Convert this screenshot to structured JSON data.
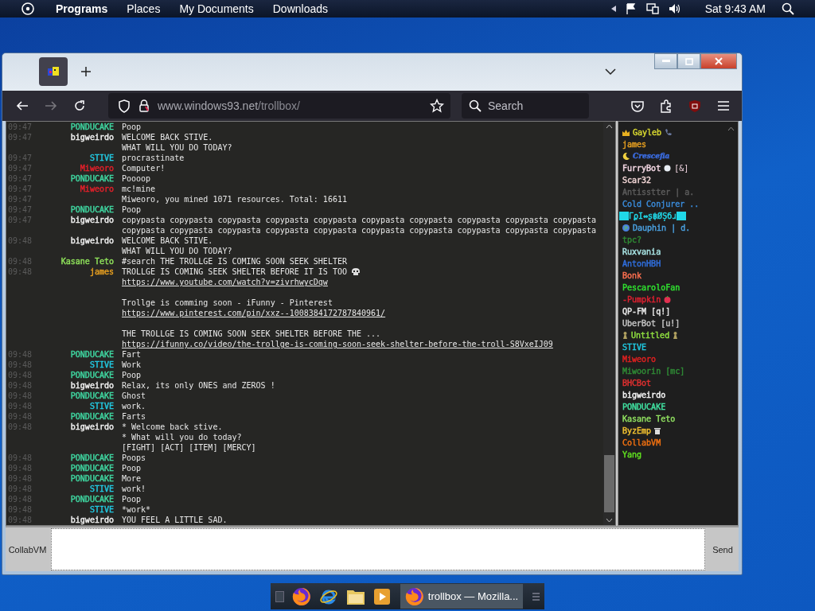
{
  "top_panel": {
    "menus": [
      "Programs",
      "Places",
      "My Documents",
      "Downloads"
    ],
    "clock": "Sat 9:43 AM"
  },
  "browser": {
    "tabs": [
      {
        "selected": true
      }
    ],
    "url_host": "www.windows93.net",
    "url_path": "/trollbox/",
    "search": {
      "placeholder": "Search"
    }
  },
  "chat": {
    "messages": [
      {
        "time": "09:47",
        "nick": "PONDUCAKE",
        "color": "#3fd6a0",
        "lines": [
          {
            "text": "Poop"
          }
        ]
      },
      {
        "time": "09:47",
        "nick": "bigweirdo",
        "color": "#f0f0f0",
        "lines": [
          {
            "text": "WELCOME BACK STIVE."
          },
          {
            "text": "WHAT WILL YOU DO TODAY?"
          }
        ]
      },
      {
        "time": "09:47",
        "nick": "STIVE",
        "color": "#22c8e0",
        "lines": [
          {
            "text": "procrastinate"
          }
        ]
      },
      {
        "time": "09:47",
        "nick": "Miweoro",
        "color": "#e0202a",
        "lines": [
          {
            "text": "Computer!"
          }
        ]
      },
      {
        "time": "09:47",
        "nick": "PONDUCAKE",
        "color": "#3fd6a0",
        "lines": [
          {
            "text": "Poooop"
          }
        ]
      },
      {
        "time": "09:47",
        "nick": "Miweoro",
        "color": "#e0202a",
        "lines": [
          {
            "text": "mc!mine"
          }
        ]
      },
      {
        "time": "09:47",
        "lines": [
          {
            "text": "Miweoro, you mined 1071 resources. Total: 16611"
          }
        ]
      },
      {
        "time": "09:47",
        "nick": "PONDUCAKE",
        "color": "#3fd6a0",
        "lines": [
          {
            "text": "Poop"
          }
        ]
      },
      {
        "time": "09:47",
        "nick": "bigweirdo",
        "color": "#f0f0f0",
        "lines": [
          {
            "text": "copypasta copypasta copypasta copypasta copypasta copypasta copypasta copypasta copypasta copypasta"
          },
          {
            "text": "copypasta copypasta copypasta copypasta copypasta copypasta copypasta copypasta copypasta copypasta"
          }
        ]
      },
      {
        "time": "09:48",
        "nick": "bigweirdo",
        "color": "#f0f0f0",
        "lines": [
          {
            "text": "WELCOME BACK STIVE."
          },
          {
            "text": "WHAT WILL YOU DO TODAY?"
          }
        ]
      },
      {
        "time": "09:48",
        "nick": "Kasane Teto",
        "color": "#8ee05a",
        "lines": [
          {
            "text": "#search THE TROLLGE IS COMING SOON SEEK SHELTER"
          }
        ]
      },
      {
        "time": "09:48",
        "nick": "james",
        "color": "#e8a020",
        "lines": [
          {
            "text": "TROLLGE IS COMING SEEK SHELTER BEFORE IT IS TOO"
          },
          {
            "text": "https://www.youtube.com/watch?v=zivrhwycDqw",
            "link": true
          },
          {
            "text": "Trollge is comming soon - iFunny - Pinterest",
            "space_before": true
          },
          {
            "text": "https://www.pinterest.com/pin/xxz--1008384172787840961/",
            "link": true
          },
          {
            "text": "THE TROLLGE IS COMING SOON SEEK SHELTER BEFORE THE ...",
            "space_before": true
          },
          {
            "text": "https://ifunny.co/video/the-trollge-is-coming-soon-seek-shelter-before-the-troll-S8VxeIJ09",
            "link": true
          }
        ]
      },
      {
        "time": "09:48",
        "nick": "PONDUCAKE",
        "color": "#3fd6a0",
        "lines": [
          {
            "text": "Fart"
          }
        ]
      },
      {
        "time": "09:48",
        "nick": "STIVE",
        "color": "#22c8e0",
        "lines": [
          {
            "text": "Work"
          }
        ]
      },
      {
        "time": "09:48",
        "nick": "PONDUCAKE",
        "color": "#3fd6a0",
        "lines": [
          {
            "text": "Poop"
          }
        ]
      },
      {
        "time": "09:48",
        "nick": "bigweirdo",
        "color": "#f0f0f0",
        "lines": [
          {
            "text": "Relax, its only ONES and ZEROS !"
          }
        ]
      },
      {
        "time": "09:48",
        "nick": "PONDUCAKE",
        "color": "#3fd6a0",
        "lines": [
          {
            "text": "Ghost"
          }
        ]
      },
      {
        "time": "09:48",
        "nick": "STIVE",
        "color": "#22c8e0",
        "lines": [
          {
            "text": "work."
          }
        ]
      },
      {
        "time": "09:48",
        "nick": "PONDUCAKE",
        "color": "#3fd6a0",
        "lines": [
          {
            "text": "Farts"
          }
        ]
      },
      {
        "time": "09:48",
        "nick": "bigweirdo",
        "color": "#f0f0f0",
        "lines": [
          {
            "text": "* Welcome back stive."
          },
          {
            "text": "* What will you do today?"
          },
          {
            "text": "[FIGHT] [ACT] [ITEM] [MERCY]"
          }
        ]
      },
      {
        "time": "09:48",
        "nick": "PONDUCAKE",
        "color": "#3fd6a0",
        "lines": [
          {
            "text": "Poops"
          }
        ]
      },
      {
        "time": "09:48",
        "nick": "PONDUCAKE",
        "color": "#3fd6a0",
        "lines": [
          {
            "text": "Poop"
          }
        ]
      },
      {
        "time": "09:48",
        "nick": "PONDUCAKE",
        "color": "#3fd6a0",
        "lines": [
          {
            "text": "More"
          }
        ]
      },
      {
        "time": "09:48",
        "nick": "STIVE",
        "color": "#22c8e0",
        "lines": [
          {
            "text": "work!"
          }
        ]
      },
      {
        "time": "09:48",
        "nick": "PONDUCAKE",
        "color": "#3fd6a0",
        "lines": [
          {
            "text": "Poop"
          }
        ]
      },
      {
        "time": "09:48",
        "nick": "STIVE",
        "color": "#22c8e0",
        "lines": [
          {
            "text": "*work*"
          }
        ]
      },
      {
        "time": "09:48",
        "nick": "bigweirdo",
        "color": "#f0f0f0",
        "lines": [
          {
            "text": "YOU FEEL A LITTLE SAD."
          }
        ]
      }
    ]
  },
  "users": [
    {
      "name": "Gayleb",
      "color": "#d8d830"
    },
    {
      "name": "james",
      "color": "#e8a020"
    },
    {
      "name": "Crescefia",
      "color": "#3a6adc",
      "kind": "fancy"
    },
    {
      "name": "FurryBot",
      "color": "#f4d8e4",
      "suffix": "[&]"
    },
    {
      "name": "Scar32",
      "color": "#f0d4d4"
    },
    {
      "name": "Antisstter | a.",
      "color": "#5c5c5c"
    },
    {
      "name": "Cold Conjurer ..",
      "color": "#3a8ad8"
    },
    {
      "name": "ΓϼΙ⇔ʂ฿ØȘбɹ",
      "color": "#20d8e8"
    },
    {
      "name": "Dauphin | d.",
      "color": "#4aa0e0"
    },
    {
      "name": "tpc?",
      "color": "#2f8a35"
    },
    {
      "name": "Ruxvania",
      "color": "#a8e4e4"
    },
    {
      "name": "AntonHBH",
      "color": "#3070e0"
    },
    {
      "name": "Bonk",
      "color": "#ff7050"
    },
    {
      "name": "PescaroloFan",
      "color": "#30e030"
    },
    {
      "name": "-Pumpkin",
      "color": "#e02030"
    },
    {
      "name": "QP-FM [q!]",
      "color": "#e8e8e8"
    },
    {
      "name": "UberBot [u!]",
      "color": "#c4c4c4"
    },
    {
      "name": "Untitled",
      "color": "#90e040"
    },
    {
      "name": "STIVE",
      "color": "#20c8e0"
    },
    {
      "name": "Miweoro",
      "color": "#e02020"
    },
    {
      "name": "Miwoorin [mc]",
      "color": "#2f8a35"
    },
    {
      "name": "BHCBot",
      "color": "#e03030"
    },
    {
      "name": "bigweirdo",
      "color": "#f4f4f4"
    },
    {
      "name": "PONDUCAKE",
      "color": "#40e0a0"
    },
    {
      "name": "Kasane Teto",
      "color": "#90e060"
    },
    {
      "name": "ByzEmp",
      "color": "#f0c030"
    },
    {
      "name": "CollabVM",
      "color": "#f07010"
    },
    {
      "name": "Yang",
      "color": "#60e020"
    }
  ],
  "input": {
    "left_button": "CollabVM",
    "send_button": "Send"
  },
  "taskbar": {
    "task": "trollbox — Mozilla..."
  }
}
